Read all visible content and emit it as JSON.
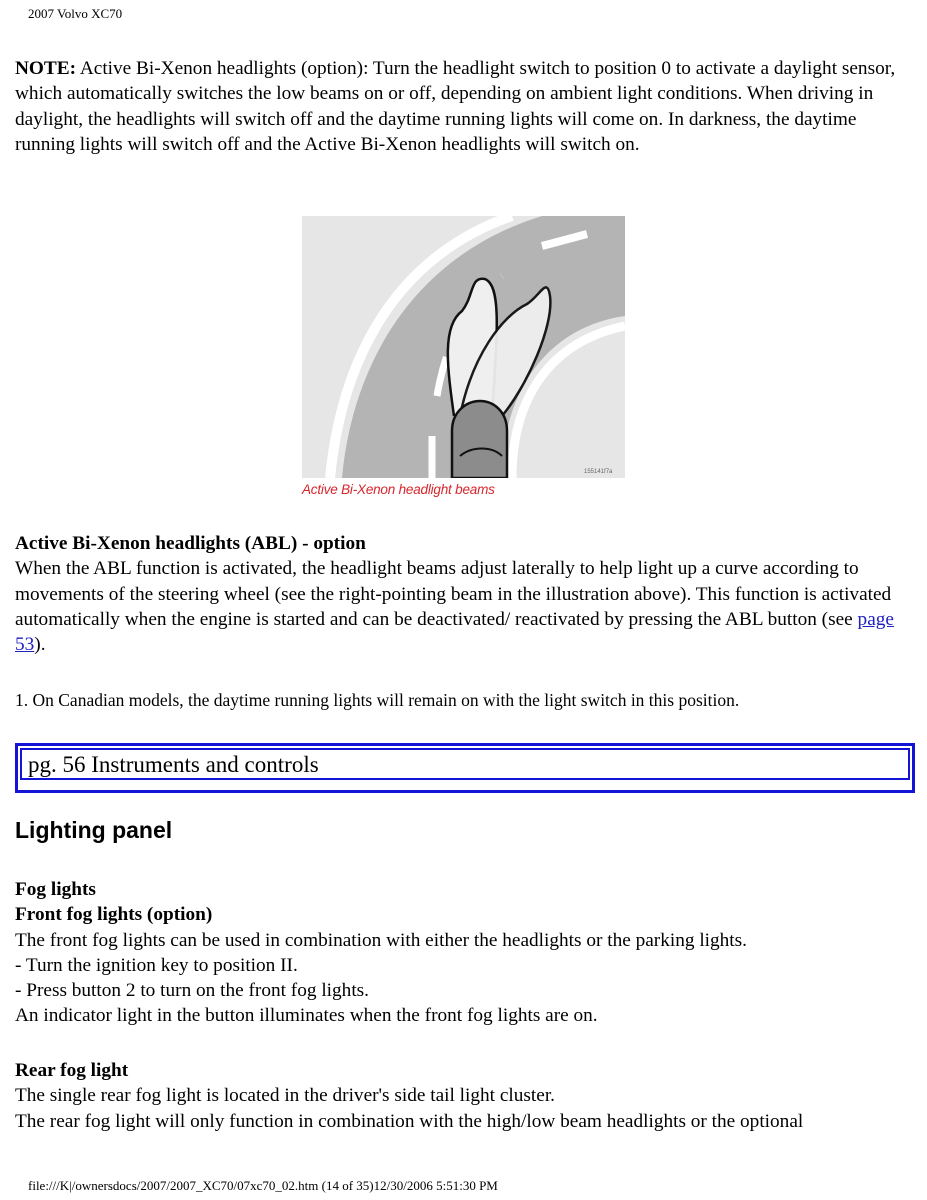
{
  "header": {
    "title": "2007 Volvo XC70"
  },
  "note": {
    "label": "NOTE:",
    "text": " Active Bi-Xenon headlights (option): Turn the headlight switch to position 0 to activate a daylight sensor, which automatically switches the low beams on or off, depending on ambient light conditions. When driving in daylight, the headlights will switch off and the daytime running lights will come on. In darkness, the daytime running lights will switch off and the Active Bi-Xenon headlights will switch on."
  },
  "figure": {
    "caption": "Active Bi-Xenon headlight beams",
    "code": "155141f7a",
    "colors": {
      "road": "#b4b4b4",
      "background": "#e6e6e6",
      "caption": "#d7262c"
    }
  },
  "abl": {
    "heading": "Active Bi-Xenon headlights (ABL) - option",
    "text_before_link": "When the ABL function is activated, the headlight beams adjust laterally to help light up a curve according to movements of the steering wheel (see the right-pointing beam in the illustration above). This function is activated automatically when the engine is started and can be deactivated/ reactivated by pressing the ABL button (see ",
    "link": "page 53",
    "text_after_link": ")."
  },
  "footnote": "1. On Canadian models, the daytime running lights will remain on with the light switch in this position.",
  "page_marker": "pg. 56 Instruments and controls",
  "section_title": "Lighting panel",
  "fog_lights": {
    "heading": "Fog lights",
    "subheading": "Front fog lights (option)",
    "lines": [
      "The front fog lights can be used in combination with either the headlights or the parking lights.",
      "- Turn the ignition key to position II.",
      "- Press button 2 to turn on the front fog lights.",
      "An indicator light in the button illuminates when the front fog lights are on."
    ]
  },
  "rear_fog": {
    "heading": "Rear fog light",
    "lines": [
      "The single rear fog light is located in the driver's side tail light cluster.",
      "The rear fog light will only function in combination with the high/low beam headlights or the optional"
    ]
  },
  "footer": {
    "path": "file:///K|/ownersdocs/2007/2007_XC70/07xc70_02.htm (14 of 35)12/30/2006 5:51:30 PM"
  }
}
